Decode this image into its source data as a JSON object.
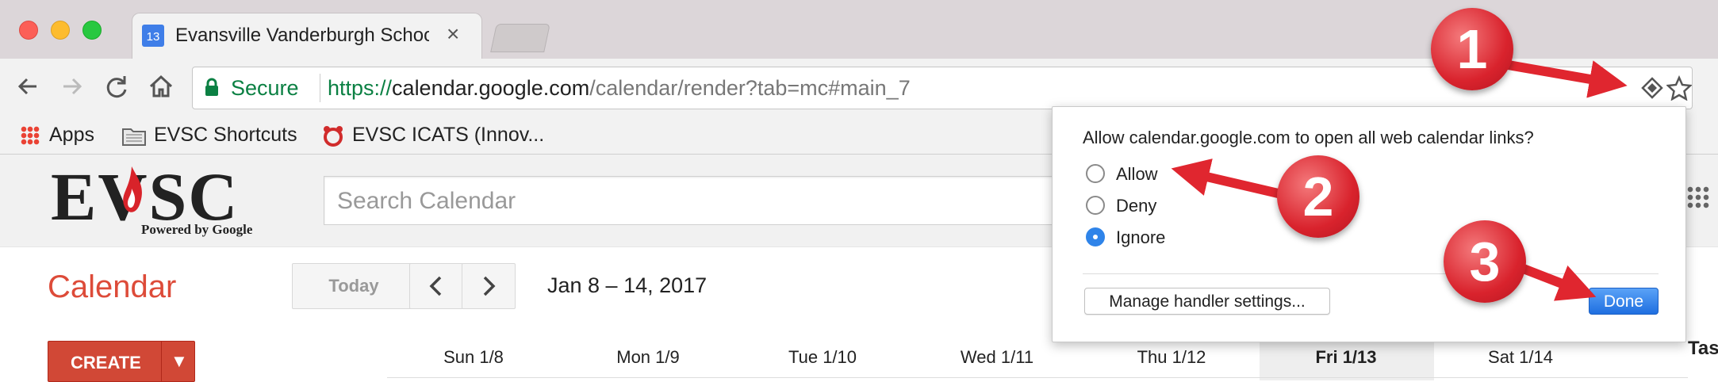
{
  "browser": {
    "tab_title": "Evansville Vanderburgh Schoo",
    "tab_favicon_text": "13",
    "url_secure_label": "Secure",
    "url_scheme": "https://",
    "url_host": "calendar.google.com",
    "url_path": "/calendar/render?tab=mc#main_7",
    "bookmarks": [
      {
        "label": "Apps",
        "icon": "apps-grid-icon"
      },
      {
        "label": "EVSC Shortcuts",
        "icon": "folder-icon"
      },
      {
        "label": "EVSC ICATS (Innov...",
        "icon": "icats-icon"
      }
    ]
  },
  "page": {
    "logo_text": "EVSC",
    "logo_sub": "Powered by Google",
    "search_placeholder": "Search Calendar",
    "calendar_title": "Calendar",
    "today_label": "Today",
    "date_range": "Jan 8 – 14, 2017",
    "create_label": "CREATE",
    "days": [
      "Sun 1/8",
      "Mon 1/9",
      "Tue 1/10",
      "Wed 1/11",
      "Thu 1/12",
      "Fri 1/13",
      "Sat 1/14"
    ],
    "selected_day_index": 5,
    "tasks_label": "Tas"
  },
  "dialog": {
    "question": "Allow calendar.google.com to open all web calendar links?",
    "options": [
      "Allow",
      "Deny",
      "Ignore"
    ],
    "selected_index": 2,
    "manage_label": "Manage handler settings...",
    "done_label": "Done"
  },
  "annotations": {
    "marker_1": "1",
    "marker_2": "2",
    "marker_3": "3",
    "color": "#e0262f"
  },
  "colors": {
    "brand_red": "#dd4b39",
    "secure_green": "#0b8043",
    "accent_blue": "#2f84e9"
  }
}
